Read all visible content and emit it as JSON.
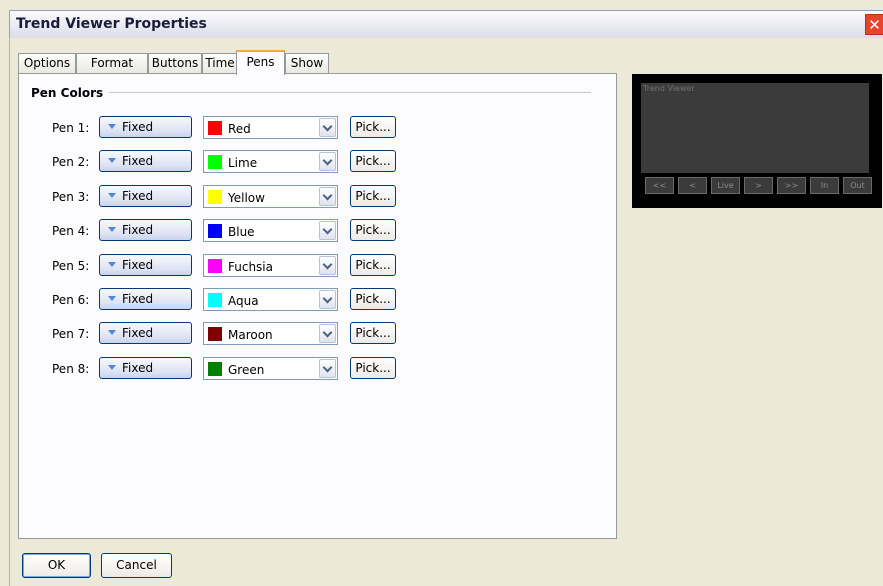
{
  "window": {
    "title": "Trend Viewer Properties",
    "close_glyph": "✕"
  },
  "tabs": [
    {
      "label": "Options"
    },
    {
      "label": "Format"
    },
    {
      "label": "Buttons"
    },
    {
      "label": "Time"
    },
    {
      "label": "Pens",
      "active": true
    },
    {
      "label": "Show"
    }
  ],
  "pen_colors": {
    "group_title": "Pen Colors",
    "pick_label": "Pick...",
    "pens": [
      {
        "label": "Pen 1:",
        "mode": "Fixed",
        "color_name": "Red",
        "color": "#ff0000"
      },
      {
        "label": "Pen 2:",
        "mode": "Fixed",
        "color_name": "Lime",
        "color": "#00ff00"
      },
      {
        "label": "Pen 3:",
        "mode": "Fixed",
        "color_name": "Yellow",
        "color": "#ffff00"
      },
      {
        "label": "Pen 4:",
        "mode": "Fixed",
        "color_name": "Blue",
        "color": "#0000ff"
      },
      {
        "label": "Pen 5:",
        "mode": "Fixed",
        "color_name": "Fuchsia",
        "color": "#ff00ff"
      },
      {
        "label": "Pen 6:",
        "mode": "Fixed",
        "color_name": "Aqua",
        "color": "#00ffff"
      },
      {
        "label": "Pen 7:",
        "mode": "Fixed",
        "color_name": "Maroon",
        "color": "#800000"
      },
      {
        "label": "Pen 8:",
        "mode": "Fixed",
        "color_name": "Green",
        "color": "#008000"
      }
    ]
  },
  "preview": {
    "plot_title": "Trend Viewer",
    "buttons": [
      "<<",
      "<",
      "Live",
      ">",
      ">>",
      "In",
      "Out"
    ]
  },
  "footer": {
    "ok_label": "OK",
    "cancel_label": "Cancel"
  }
}
